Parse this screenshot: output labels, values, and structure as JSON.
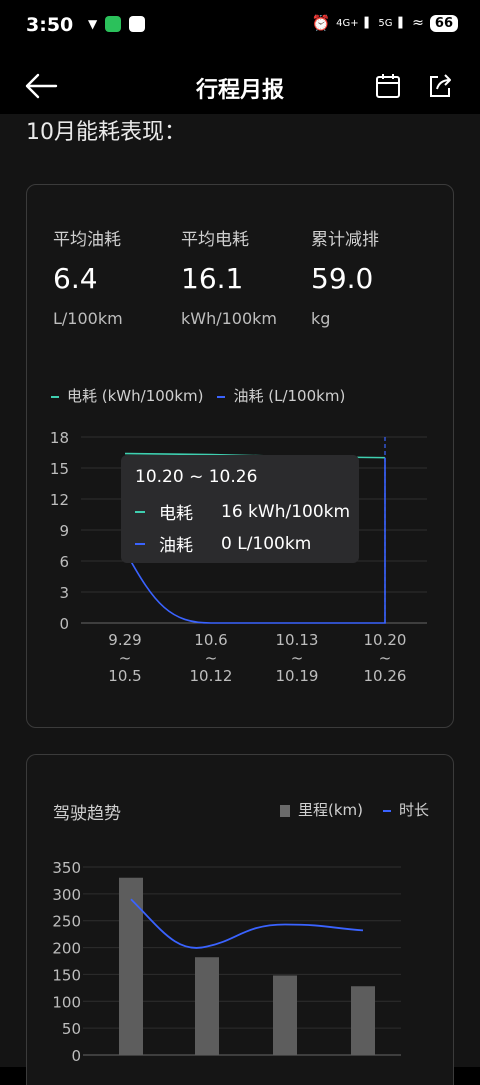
{
  "status_bar": {
    "time": "3:50",
    "network_1": "4G+",
    "network_2": "5G",
    "battery": "66"
  },
  "nav": {
    "title": "行程月报"
  },
  "section": {
    "title": "10月能耗表现："
  },
  "stats": [
    {
      "label": "平均油耗",
      "value": "6.4",
      "unit": "L/100km"
    },
    {
      "label": "平均电耗",
      "value": "16.1",
      "unit": "kWh/100km"
    },
    {
      "label": "累计减排",
      "value": "59.0",
      "unit": "kg"
    }
  ],
  "energy_legend": {
    "electric": "电耗 (kWh/100km)",
    "fuel": "油耗 (L/100km)"
  },
  "tooltip": {
    "title": "10.20 ~ 10.26",
    "rows": [
      {
        "name": "电耗",
        "value": "16 kWh/100km"
      },
      {
        "name": "油耗",
        "value": "0 L/100km"
      }
    ]
  },
  "trend": {
    "title": "驾驶趋势",
    "legend_bar": "里程(km)",
    "legend_line": "时长"
  },
  "colors": {
    "electric": "#3fcfb0",
    "fuel": "#3a63ff",
    "bar": "#5d5d5d"
  },
  "chart_data": [
    {
      "type": "line",
      "title": "",
      "categories": [
        "9.29 ~ 10.5",
        "10.6 ~ 10.12",
        "10.13 ~ 10.19",
        "10.20 ~ 10.26"
      ],
      "tick_labels": [
        [
          "9.29",
          "~",
          "10.5"
        ],
        [
          "10.6",
          "~",
          "10.12"
        ],
        [
          "10.13",
          "~",
          "10.19"
        ],
        [
          "10.20",
          "~",
          "10.26"
        ]
      ],
      "series": [
        {
          "name": "电耗 (kWh/100km)",
          "values": [
            16.4,
            16.3,
            16.1,
            16
          ]
        },
        {
          "name": "油耗 (L/100km)",
          "values": [
            7,
            0,
            0,
            0
          ]
        }
      ],
      "yticks": [
        0,
        3,
        6,
        9,
        12,
        15,
        18
      ],
      "ylim": [
        0,
        18
      ],
      "grid": true,
      "legend": "top-left"
    },
    {
      "type": "bar",
      "title": "驾驶趋势",
      "series": [
        {
          "name": "里程(km)",
          "values": [
            330,
            182,
            148,
            128
          ]
        },
        {
          "name": "时长",
          "values": [
            290,
            202,
            243,
            232
          ]
        }
      ],
      "yticks": [
        0,
        50,
        100,
        150,
        200,
        250,
        300,
        350
      ],
      "ylim": [
        0,
        350
      ],
      "grid": true,
      "legend": "top-right"
    }
  ]
}
